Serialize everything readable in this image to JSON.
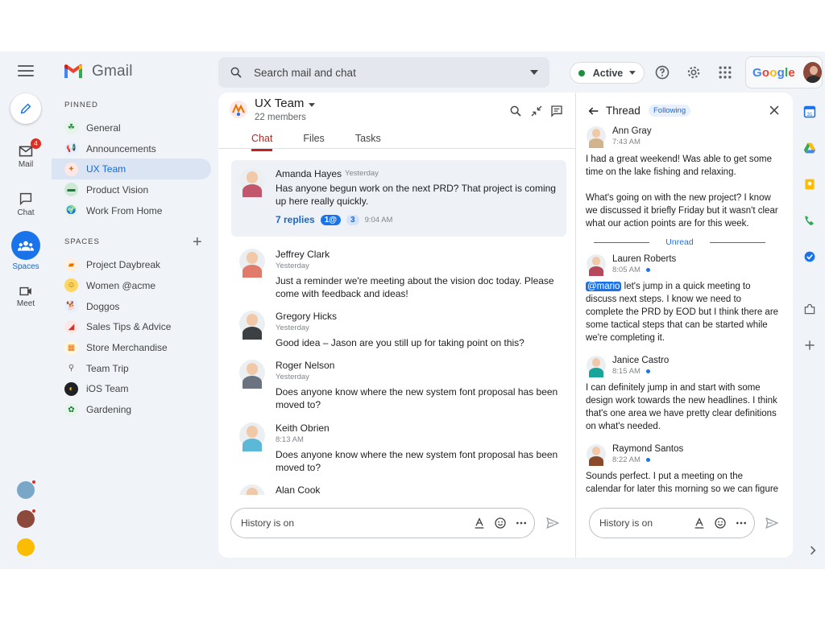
{
  "header": {
    "app_name": "Gmail",
    "search_placeholder": "Search mail and chat",
    "status": "Active",
    "google_word": [
      "G",
      "o",
      "o",
      "g",
      "l",
      "e"
    ],
    "google_colors": [
      "#4285f4",
      "#ea4335",
      "#fbbc04",
      "#4285f4",
      "#34a853",
      "#ea4335"
    ]
  },
  "rail": {
    "mail_label": "Mail",
    "mail_badge": "4",
    "chat_label": "Chat",
    "spaces_label": "Spaces",
    "meet_label": "Meet"
  },
  "sidebar": {
    "pinned_label": "PINNED",
    "pinned": [
      {
        "label": "General",
        "icon": "clover-icon",
        "color": "#e6f4ea",
        "glyph": "☘",
        "glyph_color": "#1e8e3e"
      },
      {
        "label": "Announcements",
        "icon": "megaphone-icon",
        "color": "#e8f0fe",
        "glyph": "📢",
        "glyph_color": "#1a73e8"
      },
      {
        "label": "UX Team",
        "icon": "ux-team-icon",
        "color": "#fde7e7",
        "glyph": "✦",
        "glyph_color": "#e37400"
      },
      {
        "label": "Product Vision",
        "icon": "product-vision-icon",
        "color": "#ceead6",
        "glyph": "▬",
        "glyph_color": "#188038"
      },
      {
        "label": "Work From Home",
        "icon": "globe-icon",
        "color": "#e6f4ea",
        "glyph": "🌍",
        "glyph_color": "#188038"
      }
    ],
    "spaces_label": "SPACES",
    "spaces": [
      {
        "label": "Project Daybreak",
        "icon": "project-daybreak-icon",
        "color": "#fff0e0",
        "glyph": "▰",
        "glyph_color": "#e37400"
      },
      {
        "label": "Women @acme",
        "icon": "women-acme-icon",
        "color": "#fdd663",
        "glyph": "☺",
        "glyph_color": "#b06000"
      },
      {
        "label": "Doggos",
        "icon": "dog-icon",
        "color": "#e8f0fe",
        "glyph": "🐕",
        "glyph_color": "#1a73e8"
      },
      {
        "label": "Sales Tips & Advice",
        "icon": "sales-icon",
        "color": "#fce8e6",
        "glyph": "◢",
        "glyph_color": "#d93025"
      },
      {
        "label": "Store Merchandise",
        "icon": "store-icon",
        "color": "#fef7e0",
        "glyph": "▦",
        "glyph_color": "#e37400"
      },
      {
        "label": "Team Trip",
        "icon": "team-trip-icon",
        "color": "#f1f3f4",
        "glyph": "⚲",
        "glyph_color": "#5f6368"
      },
      {
        "label": "iOS Team",
        "icon": "ios-team-icon",
        "color": "#202124",
        "glyph": "◐",
        "glyph_color": "#fbbc04"
      },
      {
        "label": "Gardening",
        "icon": "gardening-icon",
        "color": "#e6f4ea",
        "glyph": "✿",
        "glyph_color": "#188038"
      }
    ]
  },
  "space": {
    "title": "UX Team",
    "members": "22 members",
    "tabs": [
      "Chat",
      "Files",
      "Tasks"
    ]
  },
  "messages": [
    {
      "name": "Amanda Hayes",
      "time": "Yesterday",
      "body": "Has anyone begun work on the next PRD? That project is coming up here really quickly.",
      "avatar_color": "#c2566b",
      "replies_label": "7 replies",
      "mention_count": "1@",
      "unread_count": "3",
      "reply_time": "9:04 AM"
    },
    {
      "name": "Jeffrey Clark",
      "time": "Yesterday",
      "body": "Just a reminder we're meeting about the vision doc today. Please come with feedback and ideas!",
      "avatar_color": "#e07a6a"
    },
    {
      "name": "Gregory Hicks",
      "time": "Yesterday",
      "body": "Good idea – Jason are you still up for taking point on this?",
      "avatar_color": "#3c4043"
    },
    {
      "name": "Roger Nelson",
      "time": "Yesterday",
      "body": "Does anyone know where the new system font proposal has been moved to?",
      "avatar_color": "#6b7280"
    },
    {
      "name": "Keith Obrien",
      "time": "8:13 AM",
      "body": "Does anyone know where the new system font proposal has been moved to?",
      "avatar_color": "#5bb8d6"
    },
    {
      "name": "Alan Cook",
      "time": "",
      "body": "",
      "avatar_color": "#fbbc04"
    }
  ],
  "composer": {
    "placeholder": "History is on"
  },
  "thread": {
    "title": "Thread",
    "following": "Following",
    "unread_label": "Unread",
    "messages": [
      {
        "name": "Ann Gray",
        "time": "7:43 AM",
        "body": "I had a great weekend! Was able to get some time on the lake fishing and relaxing.",
        "body2": "What's going on with the new project? I know we discussed it briefly Friday but it wasn't clear what our action points are for this week.",
        "avatar_color": "#d2b48c",
        "dot": false
      },
      {
        "name": "Lauren Roberts",
        "time": "8:05 AM",
        "mention": "@mario",
        "body": " let's jump in a quick meeting to discuss next steps. I know we need to complete the PRD by EOD but I think there are some tactical steps that can be started while we're completing it.",
        "avatar_color": "#b5485a",
        "dot": true
      },
      {
        "name": "Janice Castro",
        "time": "8:15 AM",
        "body": "I can definitely jump in and start with some design work towards the new headlines. I think that's one area we have pretty clear definitions on what's needed.",
        "avatar_color": "#1aa59a",
        "dot": true
      },
      {
        "name": "Raymond Santos",
        "time": "8:22 AM",
        "body": "Sounds perfect. I put a meeting on the calendar for later this morning so we can figure out the specifics of the PRD.",
        "avatar_color": "#8a4b2a",
        "dot": true
      }
    ]
  }
}
